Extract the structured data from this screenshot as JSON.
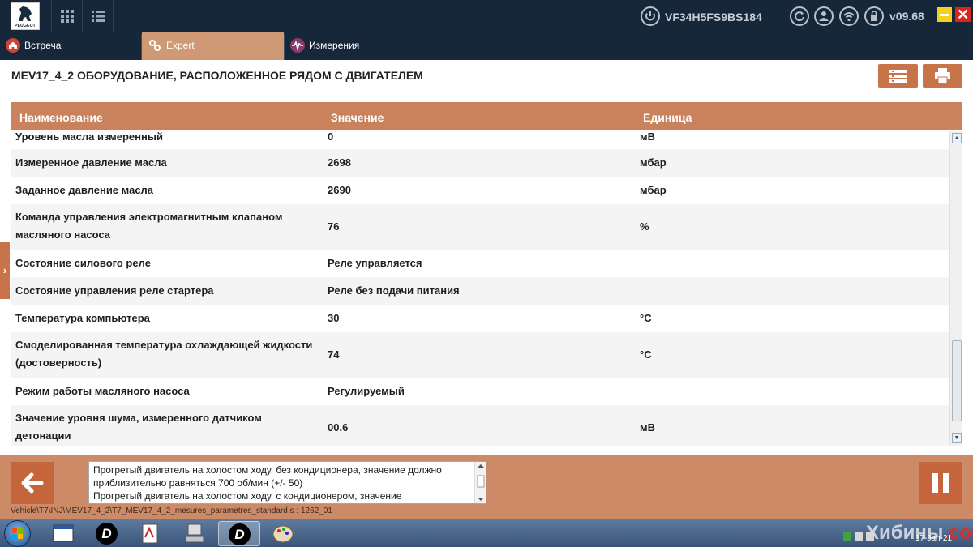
{
  "header": {
    "brand": "PEUGEOT",
    "vin": "VF34H5FS9BS184",
    "version": "v09.68"
  },
  "tabs": [
    {
      "label": "Встреча"
    },
    {
      "label": "Expert"
    },
    {
      "label": "Измерения"
    }
  ],
  "page": {
    "title": "MEV17_4_2   ОБОРУДОВАНИЕ, РАСПОЛОЖЕННОЕ РЯДОМ С ДВИГАТЕЛЕМ"
  },
  "table": {
    "columns": [
      "Наименование",
      "Значение",
      "Единица"
    ],
    "rows": [
      {
        "name": "Уровень масла измеренный",
        "value": "0",
        "unit": "мВ"
      },
      {
        "name": "Измеренное давление масла",
        "value": "2698",
        "unit": "мбар"
      },
      {
        "name": "Заданное давление масла",
        "value": "2690",
        "unit": "мбар"
      },
      {
        "name": "Команда управления электромагнитным клапаном масляного насоса",
        "value": "76",
        "unit": "%"
      },
      {
        "name": "Состояние силового реле",
        "value": "Реле управляется",
        "unit": ""
      },
      {
        "name": "Состояние управления реле стартера",
        "value": "Реле без подачи питания",
        "unit": ""
      },
      {
        "name": "Температура компьютера",
        "value": "30",
        "unit": "°C"
      },
      {
        "name": "Смоделированная температура охлаждающей жидкости (достоверность)",
        "value": "74",
        "unit": "°C"
      },
      {
        "name": "Режим работы масляного насоса",
        "value": "Регулируемый",
        "unit": ""
      },
      {
        "name": "Значение уровня шума, измеренного датчиком детонации",
        "value": "00.6",
        "unit": "мВ"
      }
    ]
  },
  "message": {
    "text": "Прогретый двигатель на холостом ходу, без кондиционера, значение должно приблизительно равняться 700 об/мин (+/- 50)\nПрогретый двигатель на холостом ходу, с кондиционером, значение"
  },
  "path": "Vehicle\\T7\\INJ\\MEV17_4_2\\T7_MEV17_4_2_mesures_parametres_standard.s : 1262_01",
  "taskbar": {
    "date": "17-Jan-21",
    "watermark_main": "Хибины",
    "watermark_suffix": ".com"
  },
  "colors": {
    "header_bg": "#17273a",
    "accent": "#c9825c",
    "button": "#c8744a",
    "bottom_bg": "#cd8a67"
  },
  "icons": {
    "top": [
      "grid-icon",
      "list-icon",
      "power-icon",
      "refresh-icon",
      "user-icon",
      "wifi-icon",
      "lock-icon"
    ],
    "tabs": [
      "home-icon",
      "tools-icon",
      "waveform-icon"
    ]
  }
}
